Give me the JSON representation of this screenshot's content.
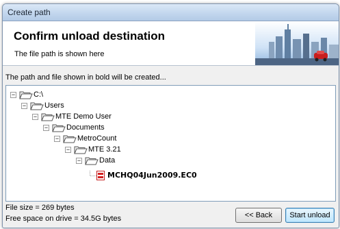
{
  "window": {
    "title": "Create path"
  },
  "banner": {
    "heading": "Confirm unload destination",
    "subtitle": "The file path is shown here",
    "logo_icon": "city-skyline-icon"
  },
  "instruction": "The path and file shown in bold will be created...",
  "tree": {
    "nodes": [
      {
        "label": "C:\\",
        "icon": "open-folder-icon",
        "expanded": true
      },
      {
        "label": "Users",
        "icon": "open-folder-icon",
        "expanded": true
      },
      {
        "label": "MTE Demo User",
        "icon": "open-folder-icon",
        "expanded": true
      },
      {
        "label": "Documents",
        "icon": "open-folder-icon",
        "expanded": true
      },
      {
        "label": "MetroCount",
        "icon": "open-folder-icon",
        "expanded": true
      },
      {
        "label": "MTE 3.21",
        "icon": "open-folder-icon",
        "expanded": true
      },
      {
        "label": "Data",
        "icon": "open-folder-icon",
        "expanded": true
      },
      {
        "label": "MCHQ04Jun2009.EC0",
        "icon": "data-file-icon",
        "bold": true
      }
    ]
  },
  "status": {
    "file_size": "File size = 269 bytes",
    "free_space": "Free space on drive = 34.5G bytes"
  },
  "buttons": {
    "back": "<< Back",
    "start": "Start unload"
  },
  "colors": {
    "title_bar": "#c3d7ee",
    "dialog_bg": "#f0f0f0",
    "file_icon": "#d42020"
  }
}
